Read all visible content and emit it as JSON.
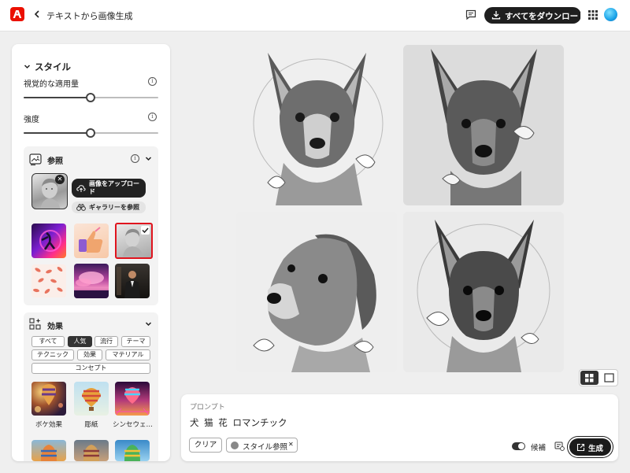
{
  "header": {
    "title": "テキストから画像生成",
    "download_all": "すべてをダウンロード",
    "icons": [
      "adobe-logo",
      "back-chevron-icon",
      "feedback-icon",
      "download-icon",
      "apps-grid-icon",
      "user-avatar"
    ]
  },
  "style_panel": {
    "section_title": "スタイル",
    "visual_intensity_label": "視覚的な適用量",
    "visual_intensity_value": 0.5,
    "strength_label": "強度",
    "strength_value": 0.5,
    "reference": {
      "title": "参照",
      "upload_label": "画像をアップロード",
      "gallery_label": "ギャラリーを参照",
      "thumbnails": [
        "neon-figure",
        "thumbs-up",
        "marble-bust",
        "koi-pattern",
        "pink-clouds",
        "man-in-suit"
      ],
      "selected_thumbnail": "marble-bust"
    },
    "effects": {
      "title": "効果",
      "chips": [
        "すべて",
        "人気",
        "流行",
        "テーマ",
        "テクニック",
        "効果",
        "マテリアル",
        "コンセプト"
      ],
      "active_chip": "人気",
      "items": [
        {
          "label": "ボケ効果"
        },
        {
          "label": "彫紙"
        },
        {
          "label": "シンセウェ…"
        }
      ]
    }
  },
  "gallery": {
    "images": [
      "dog-sketch-1",
      "dog-sketch-2",
      "dog-sketch-3",
      "dog-sketch-4"
    ]
  },
  "prompt": {
    "label": "プロンプト",
    "text": "犬 猫 花 ロマンチック",
    "clear_label": "クリア",
    "style_ref_tag": "スタイル参照",
    "candidates_label": "候補",
    "candidates_on": true,
    "generate_label": "生成"
  },
  "colors": {
    "brand_red": "#eb1000",
    "dark": "#1f1f1f",
    "selected_border": "#e0141e"
  }
}
